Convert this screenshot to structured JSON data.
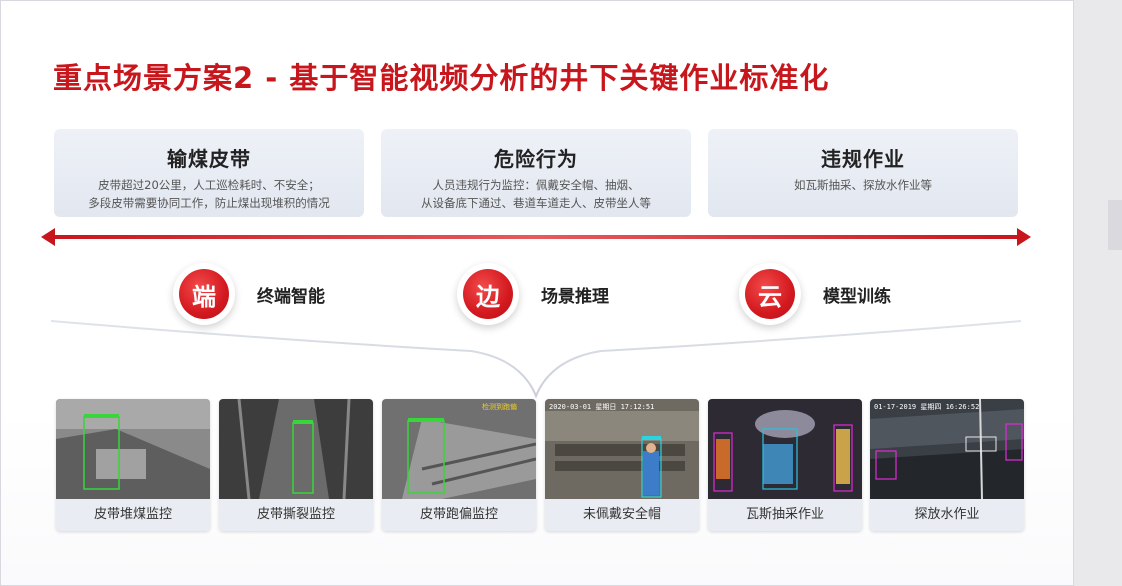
{
  "title": "重点场景方案2 - 基于智能视频分析的井下关键作业标准化",
  "cards": [
    {
      "heading": "输煤皮带",
      "line1": "皮带超过20公里，人工巡检耗时、不安全；",
      "line2": "多段皮带需要协同工作，防止煤出现堆积的情况"
    },
    {
      "heading": "危险行为",
      "line1": "人员违规行为监控：佩戴安全帽、抽烟、",
      "line2": "从设备底下通过、巷道车道走人、皮带坐人等"
    },
    {
      "heading": "违规作业",
      "line1": "如瓦斯抽采、探放水作业等",
      "line2": ""
    }
  ],
  "nodes": [
    {
      "char": "端",
      "label": "终端智能"
    },
    {
      "char": "边",
      "label": "场景推理"
    },
    {
      "char": "云",
      "label": "模型训练"
    }
  ],
  "thumbnails": [
    {
      "caption": "皮带堆煤监控",
      "overlay": ""
    },
    {
      "caption": "皮带撕裂监控",
      "overlay": ""
    },
    {
      "caption": "皮带跑偏监控",
      "overlay": "检测到跑偏"
    },
    {
      "caption": "未佩戴安全帽",
      "overlay": "2020-03-01 星期日 17:12:51"
    },
    {
      "caption": "瓦斯抽采作业",
      "overlay": ""
    },
    {
      "caption": "探放水作业",
      "overlay": "01-17-2019 星期四 16:26:52"
    }
  ],
  "colors": {
    "accent": "#c8161d",
    "card_bg": "#e6eaf2"
  }
}
